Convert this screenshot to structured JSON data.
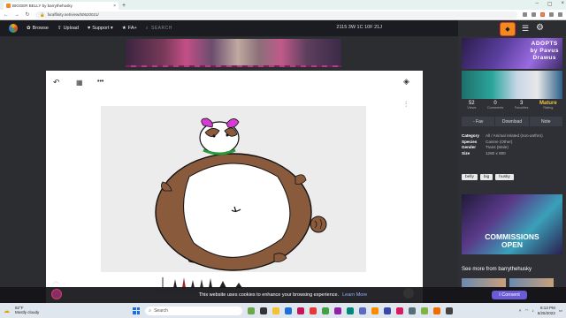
{
  "browser": {
    "tab_title": "BIGGER BELLY by barrythehusky",
    "url": "furaffinity.net/view/50620021/",
    "new_tab": "+"
  },
  "sitenav": {
    "browse": "Browse",
    "upload": "Upload",
    "support": "Support ▾",
    "fa_plus": "FA+",
    "search": "SEARCH",
    "stats": "2115 3W 1C 10F 21J"
  },
  "viewer": {
    "back_icon": "↶",
    "grid_icon": "▦",
    "more_icon": "•••",
    "layers_icon": "◈",
    "sliders_icon": "⫶"
  },
  "sidebar": {
    "ad_top_text": [
      "ADOPTS",
      "by Pavus",
      "Drawus"
    ],
    "counts": [
      {
        "value": "52",
        "label": "Views"
      },
      {
        "value": "0",
        "label": "Comments"
      },
      {
        "value": "3",
        "label": "Favorites"
      },
      {
        "value": "Mature",
        "label": "Rating"
      }
    ],
    "actions": [
      "- Fav",
      "Download",
      "Note"
    ],
    "meta": [
      {
        "k": "Category",
        "v": "All / Animal related (non-anthro)"
      },
      {
        "k": "Species",
        "v": "Canine (Other)"
      },
      {
        "k": "Gender",
        "v": "Trans (Male)"
      },
      {
        "k": "Size",
        "v": "1280 x 800"
      }
    ],
    "tags": [
      "belly",
      "big",
      "husky"
    ],
    "ad_mid_text": [
      "COMMISSIONS",
      "OPEN"
    ],
    "more_label": "See more from barrythehusky"
  },
  "cookie": {
    "text": "This website uses cookies to enhance your browsing experience.",
    "link": "Learn More",
    "accept": "I Consent"
  },
  "taskbar": {
    "temp": "82°F",
    "weather": "Mostly cloudy",
    "search": "Search",
    "time": "8:13 PM",
    "date": "6/25/2023"
  },
  "colors": {
    "accent": "#6b5bd6",
    "fa_orange": "#f38a1e",
    "mature": "#f0c24a"
  }
}
